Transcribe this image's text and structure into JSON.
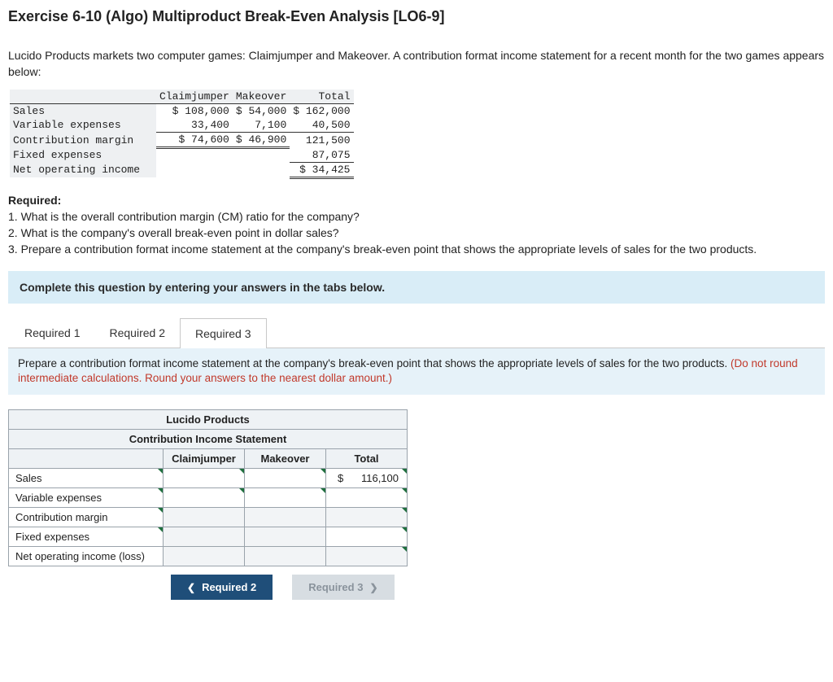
{
  "title": "Exercise 6-10 (Algo) Multiproduct Break-Even Analysis [LO6-9]",
  "intro": "Lucido Products markets two computer games: Claimjumper and Makeover. A contribution format income statement for a recent month for the two games appears below:",
  "incomeStatement": {
    "cols": [
      "Claimjumper",
      "Makeover",
      "Total"
    ],
    "rows": [
      {
        "label": "Sales",
        "c1": "$ 108,000",
        "c2": "$ 54,000",
        "c3": "$ 162,000"
      },
      {
        "label": "Variable expenses",
        "c1": "33,400",
        "c2": "7,100",
        "c3": "40,500"
      },
      {
        "label": "Contribution margin",
        "c1": "$ 74,600",
        "c2": "$ 46,900",
        "c3": "121,500"
      },
      {
        "label": "Fixed expenses",
        "c1": "",
        "c2": "",
        "c3": "87,075"
      },
      {
        "label": "Net operating income",
        "c1": "",
        "c2": "",
        "c3": "$ 34,425"
      }
    ]
  },
  "requiredHeader": "Required:",
  "requiredItems": [
    "1. What is the overall contribution margin (CM) ratio for the company?",
    "2. What is the company's overall break-even point in dollar sales?",
    "3. Prepare a contribution format income statement at the company's break-even point that shows the appropriate levels of sales for the two products."
  ],
  "blueBar": "Complete this question by entering your answers in the tabs below.",
  "tabs": [
    "Required 1",
    "Required 2",
    "Required 3"
  ],
  "activeTab": 2,
  "instruction": {
    "main": "Prepare a contribution format income statement at the company's break-even point that shows the appropriate levels of sales for the two products. ",
    "red": "(Do not round intermediate calculations. Round your answers to the nearest dollar amount.)"
  },
  "answer": {
    "title1": "Lucido Products",
    "title2": "Contribution Income Statement",
    "cols": [
      "Claimjumper",
      "Makeover",
      "Total"
    ],
    "rows": [
      {
        "label": "Sales",
        "c1": "",
        "c2": "",
        "c3sym": "$",
        "c3": "116,100",
        "dropdown": true
      },
      {
        "label": "Variable expenses",
        "c1": "",
        "c2": "",
        "c3": "",
        "dropdown": true
      },
      {
        "label": "Contribution margin",
        "c1": "",
        "c2": "",
        "c3": "",
        "dropdown": true,
        "noinput": true
      },
      {
        "label": "Fixed expenses",
        "c1": "",
        "c2": "",
        "c3": "",
        "dropdown": true
      },
      {
        "label": "Net operating income (loss)",
        "c1": "",
        "c2": "",
        "c3": "",
        "dropdown": false,
        "noinput": true
      }
    ]
  },
  "nav": {
    "prev": "Required 2",
    "next": "Required 3"
  }
}
